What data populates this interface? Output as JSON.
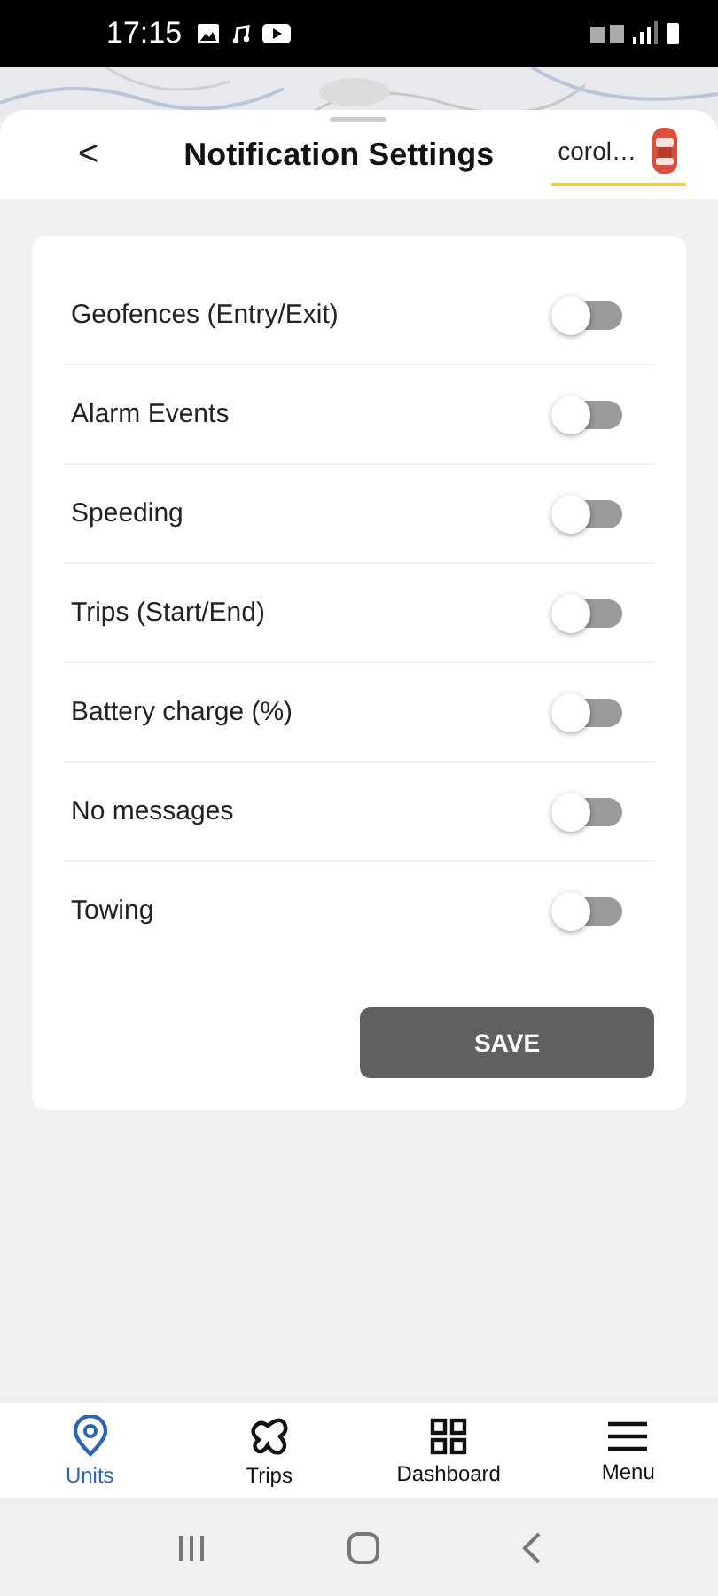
{
  "status_bar": {
    "time": "17:15"
  },
  "header": {
    "back": "<",
    "title": "Notification Settings",
    "unit": "corol…"
  },
  "settings": [
    {
      "label": "Geofences (Entry/Exit)",
      "on": false
    },
    {
      "label": "Alarm Events",
      "on": false
    },
    {
      "label": "Speeding",
      "on": false
    },
    {
      "label": "Trips (Start/End)",
      "on": false
    },
    {
      "label": "Battery charge (%)",
      "on": false
    },
    {
      "label": "No messages",
      "on": false
    },
    {
      "label": "Towing",
      "on": false
    }
  ],
  "save_button": "SAVE",
  "bottom_nav": [
    {
      "kind": "pin",
      "label": "Units",
      "selected": true
    },
    {
      "kind": "route",
      "label": "Trips",
      "selected": false
    },
    {
      "kind": "grid",
      "label": "Dashboard",
      "selected": false
    },
    {
      "kind": "menu",
      "label": "Menu",
      "selected": false
    }
  ]
}
